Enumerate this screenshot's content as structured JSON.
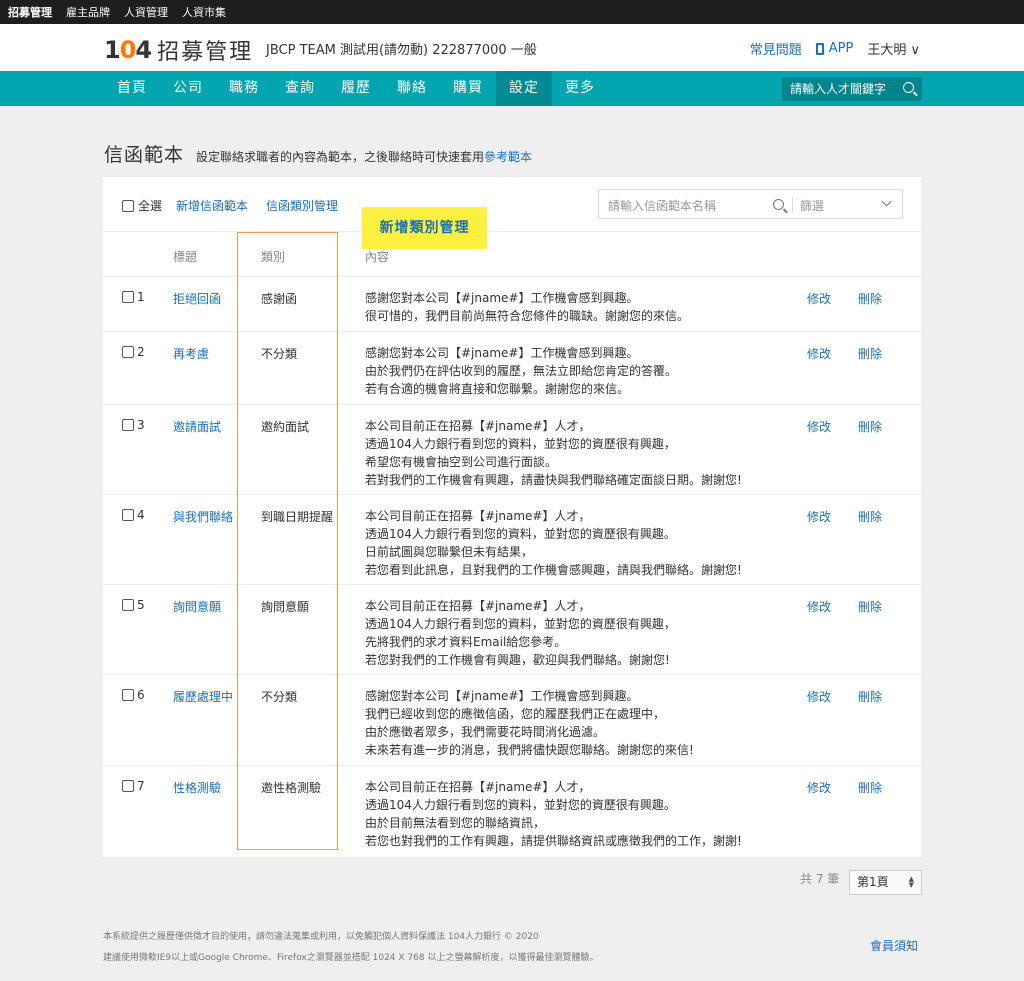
{
  "topbar": {
    "items": [
      "招募管理",
      "雇主品牌",
      "人資管理",
      "人資市集"
    ]
  },
  "header": {
    "logo_num_a": "1",
    "logo_num_zero": "0",
    "logo_num_b": "4",
    "logo_text": "招募管理",
    "company": "JBCP TEAM 測試用(請勿動) 222877000 一般",
    "faq": "常見問題",
    "app": "APP",
    "user": "王大明 ∨"
  },
  "nav": {
    "items": [
      "首頁",
      "公司",
      "職務",
      "查詢",
      "履歷",
      "聯絡",
      "購買",
      "設定",
      "更多"
    ],
    "search_placeholder": "請輸入人才關鍵字"
  },
  "page": {
    "title": "信函範本",
    "desc": "設定聯絡求職者的內容為範本，之後聯絡時可快速套用",
    "desc_link": "參考範本"
  },
  "toolbar": {
    "select_all": "全選",
    "add_template": "新增信函範本",
    "category_manage": "信函類別管理",
    "search_placeholder": "請輸入信函範本名稱",
    "filter": "篩選"
  },
  "table": {
    "headers": {
      "title": "標題",
      "category": "類別",
      "content": "內容"
    },
    "edit_label": "修改",
    "delete_label": "刪除",
    "rows": [
      {
        "num": "1",
        "title": "拒絕回函",
        "category": "感謝函",
        "lines": [
          "感謝您對本公司【#jname#】工作機會感到興趣。",
          "很可惜的，我們目前尚無符合您條件的職缺。謝謝您的來信。"
        ]
      },
      {
        "num": "2",
        "title": "再考慮",
        "category": "不分類",
        "lines": [
          "感謝您對本公司【#jname#】工作機會感到興趣。",
          "由於我們仍在評估收到的履歷，無法立即給您肯定的答覆。",
          "若有合適的機會將直接和您聯繫。謝謝您的來信。"
        ]
      },
      {
        "num": "3",
        "title": "邀請面試",
        "category": "邀約面試",
        "lines": [
          "本公司目前正在招募【#jname#】人才，",
          "透過104人力銀行看到您的資料，並對您的資歷很有興趣，",
          "希望您有機會抽空到公司進行面談。",
          "若對我們的工作機會有興趣，請盡快與我們聯絡確定面談日期。謝謝您!"
        ]
      },
      {
        "num": "4",
        "title": "與我們聯絡",
        "category": "到職日期提醒",
        "lines": [
          "本公司目前正在招募【#jname#】人才，",
          "透過104人力銀行看到您的資料，並對您的資歷很有興趣。",
          "日前試圖與您聯繫但未有結果，",
          "若您看到此訊息，且對我們的工作機會感興趣，請與我們聯絡。謝謝您!"
        ]
      },
      {
        "num": "5",
        "title": "詢問意願",
        "category": "詢問意願",
        "lines": [
          "本公司目前正在招募【#jname#】人才，",
          "透過104人力銀行看到您的資料，並對您的資歷很有興趣，",
          "先將我們的求才資料Email給您參考。",
          "若您對我們的工作機會有興趣，歡迎與我們聯絡。謝謝您!"
        ]
      },
      {
        "num": "6",
        "title": "履歷處理中",
        "category": "不分類",
        "lines": [
          "感謝您對本公司【#jname#】工作機會感到興趣。",
          "我們已經收到您的應徵信函，您的履歷我們正在處理中，",
          "由於應徵者眾多，我們需要花時間消化過濾。",
          "未來若有進一步的消息，我們將儘快跟您聯絡。謝謝您的來信!"
        ]
      },
      {
        "num": "7",
        "title": "性格測驗",
        "category": "邀性格測驗",
        "lines": [
          "本公司目前正在招募【#jname#】人才，",
          "透過104人力銀行看到您的資料，並對您的資歷很有興趣。",
          "由於目前無法看到您的聯絡資訊，",
          "若您也對我們的工作有興趣，請提供聯絡資訊或應徵我們的工作，謝謝!"
        ]
      }
    ]
  },
  "tooltip": "新增類別管理",
  "pager": {
    "total": "共 7 筆",
    "current": "第1頁"
  },
  "footer": {
    "line1": "本系統提供之履歷僅供徵才目的使用，請勿違法蒐集或利用，以免觸犯個人資料保護法  104人力銀行 © 2020",
    "line2": "建議使用微軟IE9以上或Google Chrome、Firefox之瀏覽器並搭配 1024 X 768 以上之螢幕解析度，以獲得最佳瀏覽體驗。",
    "member_notice": "會員須知"
  }
}
